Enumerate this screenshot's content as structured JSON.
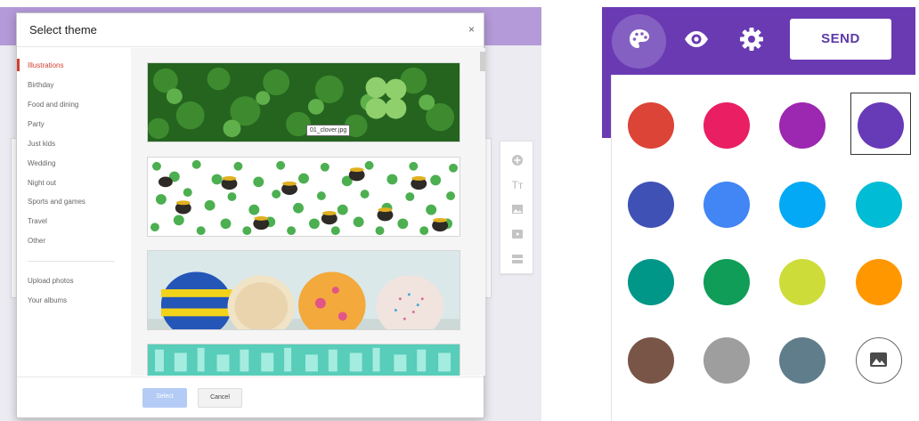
{
  "theme_dialog": {
    "title": "Select theme",
    "close": "×",
    "categories": [
      "Illustrations",
      "Birthday",
      "Food and dining",
      "Party",
      "Just kids",
      "Wedding",
      "Night out",
      "Sports and games",
      "Travel",
      "Other"
    ],
    "active_category": "Illustrations",
    "extra_links": [
      "Upload photos",
      "Your albums"
    ],
    "hover_filename": "01_clover.jpg",
    "select_label": "Select",
    "cancel_label": "Cancel"
  },
  "side_toolbar": {
    "icons": [
      "add-circle-icon",
      "title-text-icon",
      "image-icon",
      "video-icon",
      "section-icon"
    ],
    "title_icon_text": "Tт"
  },
  "color_picker": {
    "send_label": "SEND",
    "top_icons": [
      "palette-icon",
      "eye-icon",
      "gear-icon"
    ],
    "colors": [
      [
        "#db4437",
        "#e91e63",
        "#9c27b0",
        "#673ab7"
      ],
      [
        "#3f51b5",
        "#4285f4",
        "#03a9f4",
        "#00bcd4"
      ],
      [
        "#009688",
        "#0f9d58",
        "#cddc39",
        "#ff9800"
      ],
      [
        "#795548",
        "#9e9e9e",
        "#607d8b"
      ]
    ],
    "selected_color": "#673ab7",
    "custom_image_icon": "image-icon"
  }
}
